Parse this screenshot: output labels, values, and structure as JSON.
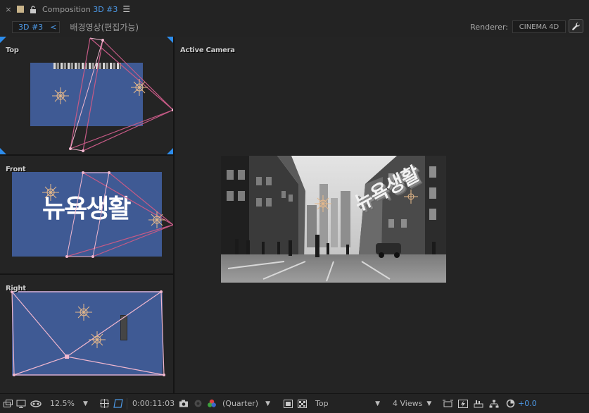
{
  "tab": {
    "close_glyph": "×",
    "title_prefix": "Composition",
    "title_accent": "3D #3",
    "menu_glyph": "☰"
  },
  "breadcrumb": {
    "active": "3D #3",
    "chevron": "<",
    "next": "배경영상(편집가능)"
  },
  "renderer": {
    "label": "Renderer:",
    "value": "CINEMA 4D"
  },
  "viewports": {
    "top": {
      "label": "Top"
    },
    "front": {
      "label": "Front"
    },
    "right": {
      "label": "Right"
    },
    "active": {
      "label": "Active Camera"
    }
  },
  "layer_text": "뉴욕생활",
  "status": {
    "zoom": "12.5%",
    "timecode": "0:00:11:03",
    "resolution": "(Quarter)",
    "view": "Top",
    "layout": "4 Views",
    "exposure": "+0.0"
  },
  "colors": {
    "accent": "#4d9ae8",
    "layer_fill": "#3f5a94",
    "camera_line": "#c65a86",
    "camera_line_light": "#f0b7cf",
    "light_icon": "#e7b98a"
  }
}
